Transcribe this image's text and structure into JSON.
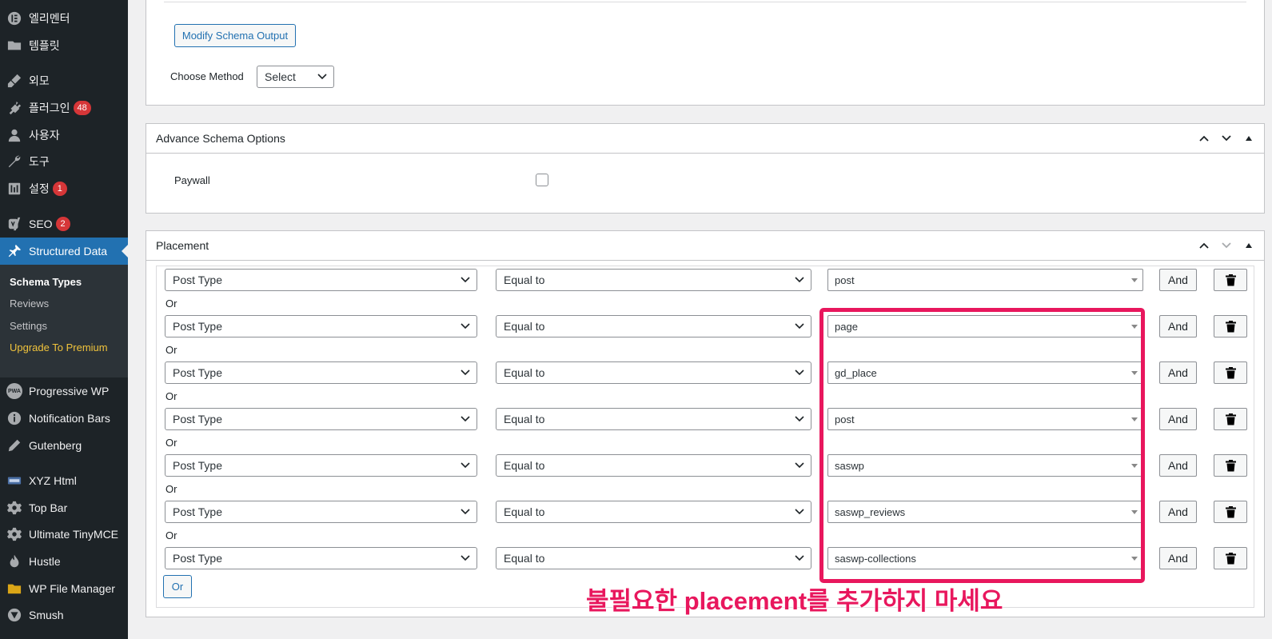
{
  "sidebar": {
    "items": [
      {
        "label": "엘리멘터",
        "icon": "elementor-icon"
      },
      {
        "label": "템플릿",
        "icon": "folder-icon"
      },
      {
        "label": "외모",
        "icon": "brush-icon"
      },
      {
        "label": "플러그인",
        "icon": "plugin-icon",
        "badge": "48"
      },
      {
        "label": "사용자",
        "icon": "user-icon"
      },
      {
        "label": "도구",
        "icon": "wrench-icon"
      },
      {
        "label": "설정",
        "icon": "settings-icon",
        "badge": "1"
      },
      {
        "label": "SEO",
        "icon": "yoast-icon",
        "badge": "2"
      },
      {
        "label": "Structured Data",
        "icon": "pin-icon"
      },
      {
        "label": "Progressive WP",
        "icon": "pwa-icon",
        "icon_text": "PWA"
      },
      {
        "label": "Notification Bars",
        "icon": "info-icon"
      },
      {
        "label": "Gutenberg",
        "icon": "pencil-icon"
      },
      {
        "label": "XYZ Html",
        "icon": "html-icon"
      },
      {
        "label": "Top Bar",
        "icon": "gear-icon"
      },
      {
        "label": "Ultimate TinyMCE",
        "icon": "gear-icon"
      },
      {
        "label": "Hustle",
        "icon": "hustle-icon"
      },
      {
        "label": "WP File Manager",
        "icon": "folder-icon"
      },
      {
        "label": "Smush",
        "icon": "smush-icon"
      }
    ],
    "submenu": [
      "Schema Types",
      "Reviews",
      "Settings",
      "Upgrade To Premium"
    ]
  },
  "top_panel": {
    "modify_button": "Modify Schema Output",
    "choose_method_label": "Choose Method",
    "method_select": "Select"
  },
  "advance_panel": {
    "title": "Advance Schema Options",
    "paywall_label": "Paywall"
  },
  "placement_panel": {
    "title": "Placement",
    "or_label": "Or",
    "and_label": "And",
    "or_button": "Or",
    "rows": [
      {
        "type": "Post Type",
        "operator": "Equal to",
        "value": "post"
      },
      {
        "type": "Post Type",
        "operator": "Equal to",
        "value": "page"
      },
      {
        "type": "Post Type",
        "operator": "Equal to",
        "value": "gd_place"
      },
      {
        "type": "Post Type",
        "operator": "Equal to",
        "value": "post"
      },
      {
        "type": "Post Type",
        "operator": "Equal to",
        "value": "saswp"
      },
      {
        "type": "Post Type",
        "operator": "Equal to",
        "value": "saswp_reviews"
      },
      {
        "type": "Post Type",
        "operator": "Equal to",
        "value": "saswp-collections"
      }
    ]
  },
  "annotation": "불필요한 placement를 추가하지 마세요",
  "colors": {
    "sidebar_bg": "#1d2327",
    "active_blue": "#2271b1",
    "highlight": "#e8175d",
    "badge": "#d63638"
  }
}
